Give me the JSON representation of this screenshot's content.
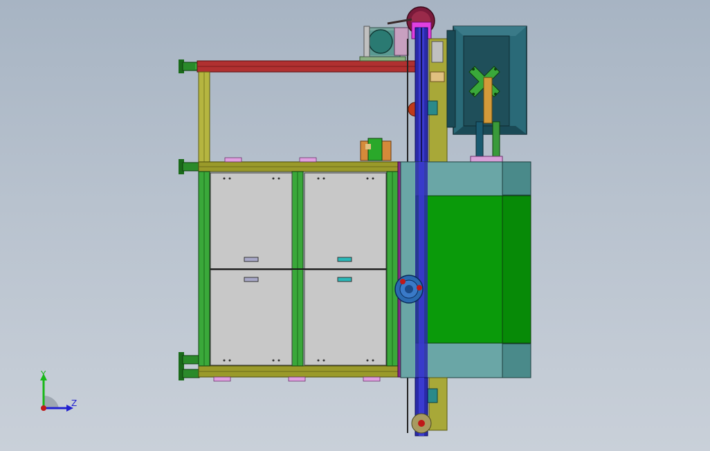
{
  "viewport": {
    "background_top": "#a7b4c3",
    "background_bottom": "#c9d0d9"
  },
  "triad": {
    "y_label": "Y",
    "z_label": "Z",
    "y_color": "#18b818",
    "z_color": "#2020d0",
    "x_color": "#c01818"
  },
  "colors": {
    "frame_olive": "#9a9a2a",
    "frame_green": "#3aa83a",
    "rail_red": "#b03030",
    "cabinet_gray": "#c8c8c8",
    "panel_teal": "#6aa6a6",
    "panel_green": "#0a9a0a",
    "belt_blue": "#2a2aa8",
    "monitor_dark": "#1f4f5a",
    "pulley_magenta": "#c030c0"
  }
}
